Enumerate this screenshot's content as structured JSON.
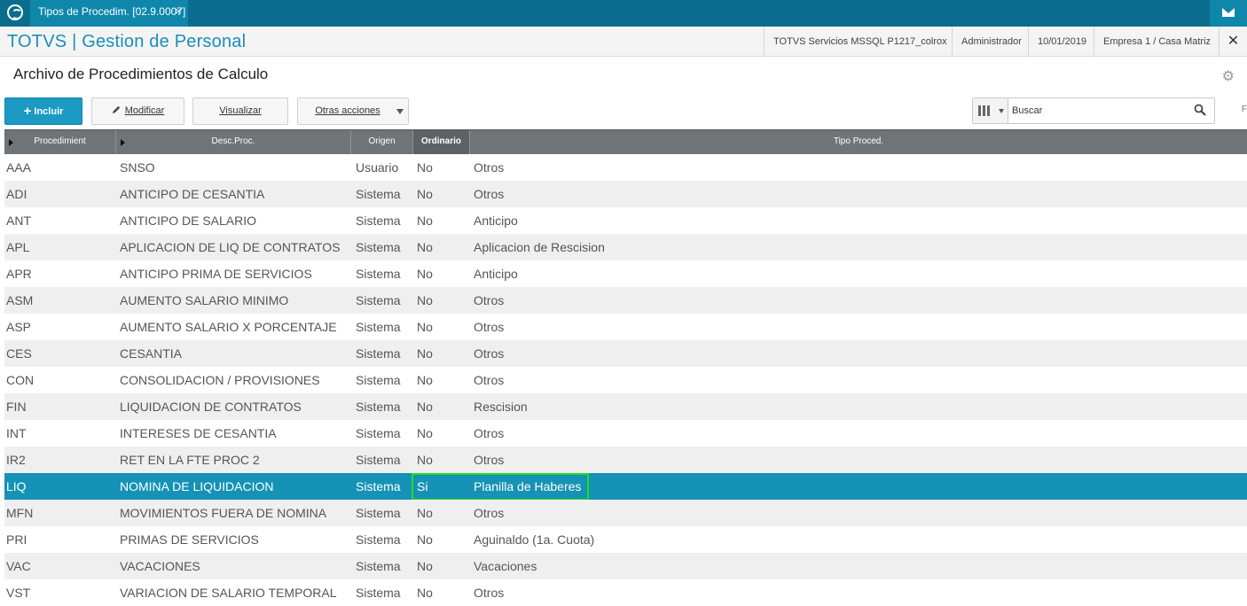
{
  "window": {
    "tab_label": "Tipos de Procedim. [02.9.0007]",
    "tab_close": "×"
  },
  "header": {
    "app_title": "TOTVS | Gestion de Personal",
    "environment": "TOTVS Servicios MSSQL P1217_colrox",
    "user": "Administrador",
    "date": "10/01/2019",
    "company": "Empresa 1 / Casa Matriz",
    "close": "✕"
  },
  "page": {
    "title": "Archivo de Procedimientos de Calculo"
  },
  "toolbar": {
    "include_label": "Incluir",
    "modify_label": "Modificar",
    "view_label": "Visualizar",
    "other_actions_label": "Otras acciones",
    "search_placeholder": "Buscar",
    "right_edge_text": "F"
  },
  "grid": {
    "columns": [
      "Procedimient",
      "Desc.Proc.",
      "Origen",
      "Ordinario",
      "Tipo Proced."
    ],
    "rows": [
      {
        "code": "AAA",
        "desc": "SNSO",
        "origin": "Usuario",
        "ordinary": "No",
        "type": "Otros"
      },
      {
        "code": "ADI",
        "desc": "ANTICIPO DE CESANTIA",
        "origin": "Sistema",
        "ordinary": "No",
        "type": "Otros"
      },
      {
        "code": "ANT",
        "desc": "ANTICIPO DE SALARIO",
        "origin": "Sistema",
        "ordinary": "No",
        "type": "Anticipo"
      },
      {
        "code": "APL",
        "desc": "APLICACION DE LIQ DE CONTRATOS",
        "origin": "Sistema",
        "ordinary": "No",
        "type": "Aplicacion de Rescision"
      },
      {
        "code": "APR",
        "desc": "ANTICIPO PRIMA DE SERVICIOS",
        "origin": "Sistema",
        "ordinary": "No",
        "type": "Anticipo"
      },
      {
        "code": "ASM",
        "desc": "AUMENTO SALARIO MINIMO",
        "origin": "Sistema",
        "ordinary": "No",
        "type": "Otros"
      },
      {
        "code": "ASP",
        "desc": "AUMENTO SALARIO X PORCENTAJE",
        "origin": "Sistema",
        "ordinary": "No",
        "type": "Otros"
      },
      {
        "code": "CES",
        "desc": "CESANTIA",
        "origin": "Sistema",
        "ordinary": "No",
        "type": "Otros"
      },
      {
        "code": "CON",
        "desc": "CONSOLIDACION / PROVISIONES",
        "origin": "Sistema",
        "ordinary": "No",
        "type": "Otros"
      },
      {
        "code": "FIN",
        "desc": "LIQUIDACION DE CONTRATOS",
        "origin": "Sistema",
        "ordinary": "No",
        "type": "Rescision"
      },
      {
        "code": "INT",
        "desc": "INTERESES DE CESANTIA",
        "origin": "Sistema",
        "ordinary": "No",
        "type": "Otros"
      },
      {
        "code": "IR2",
        "desc": "RET EN LA FTE PROC 2",
        "origin": "Sistema",
        "ordinary": "No",
        "type": "Otros"
      },
      {
        "code": "LIQ",
        "desc": "NOMINA DE LIQUIDACION",
        "origin": "Sistema",
        "ordinary": "Si",
        "type": "Planilla de Haberes"
      },
      {
        "code": "MFN",
        "desc": "MOVIMIENTOS FUERA DE NOMINA",
        "origin": "Sistema",
        "ordinary": "No",
        "type": "Otros"
      },
      {
        "code": "PRI",
        "desc": "PRIMAS DE SERVICIOS",
        "origin": "Sistema",
        "ordinary": "No",
        "type": "Aguinaldo (1a. Cuota)"
      },
      {
        "code": "VAC",
        "desc": "VACACIONES",
        "origin": "Sistema",
        "ordinary": "No",
        "type": "Vacaciones"
      },
      {
        "code": "VST",
        "desc": "VARIACION DE SALARIO TEMPORAL",
        "origin": "Sistema",
        "ordinary": "No",
        "type": "Otros"
      }
    ]
  },
  "colors": {
    "topbar": "#0b6d8d",
    "accent": "#1b9ac4",
    "selected_row": "#1592b6",
    "highlight_box": "#21e021",
    "grid_header": "#6f7478"
  }
}
